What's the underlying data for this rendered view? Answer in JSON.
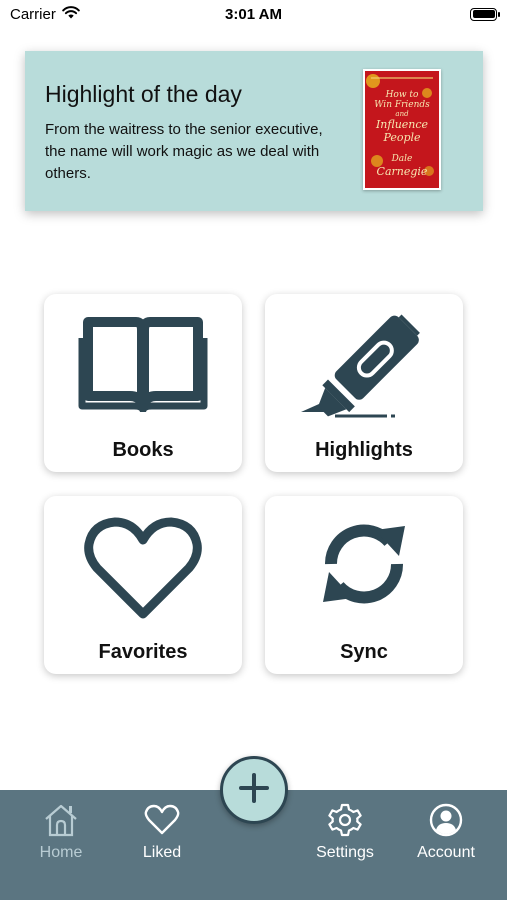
{
  "status_bar": {
    "carrier": "Carrier",
    "time": "3:01 AM",
    "battery_level": 1.0
  },
  "highlight_card": {
    "title": "Highlight of the day",
    "text": "From the waitress to the senior executive, the name will work magic as we deal with others.",
    "cover": {
      "title_lines": [
        "How to",
        "Win Friends",
        "and",
        "Influence",
        "People"
      ],
      "author_lines": [
        "Dale",
        "Carnegie"
      ]
    }
  },
  "tiles": [
    {
      "label": "Books",
      "icon": "open-book-icon"
    },
    {
      "label": "Highlights",
      "icon": "highlighter-icon"
    },
    {
      "label": "Favorites",
      "icon": "heart-icon"
    },
    {
      "label": "Sync",
      "icon": "sync-icon"
    }
  ],
  "tab_bar": {
    "items": [
      {
        "label": "Home",
        "icon": "home-icon",
        "active": true
      },
      {
        "label": "Liked",
        "icon": "heart-outline-icon",
        "active": false
      },
      {
        "label": "Settings",
        "icon": "gear-icon",
        "active": false
      },
      {
        "label": "Account",
        "icon": "account-icon",
        "active": false
      }
    ],
    "fab_icon": "plus-icon"
  },
  "colors": {
    "accent": "#b8dcda",
    "icon_dark": "#2d4652",
    "tab_bar_bg": "#5b7581",
    "tab_active": "#b8ccd3"
  }
}
